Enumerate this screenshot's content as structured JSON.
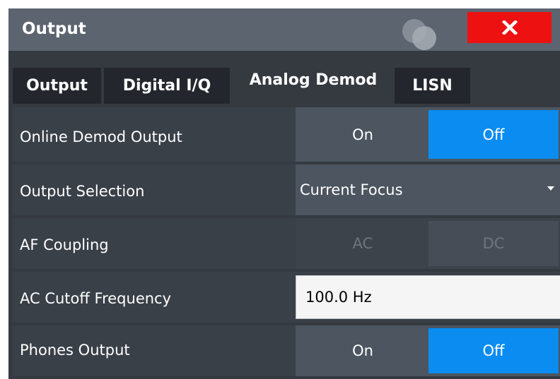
{
  "dialog": {
    "title": "Output",
    "close_label": "X"
  },
  "tabs": [
    {
      "label": "Output",
      "active": false
    },
    {
      "label": "Digital I/Q",
      "active": false
    },
    {
      "label": "Analog Demod",
      "active": true
    },
    {
      "label": "LISN",
      "active": false
    }
  ],
  "settings": {
    "online_demod": {
      "label": "Online Demod Output",
      "on": "On",
      "off": "Off",
      "selected": "Off"
    },
    "output_selection": {
      "label": "Output Selection",
      "value": "Current Focus"
    },
    "af_coupling": {
      "label": "AF Coupling",
      "ac": "AC",
      "dc": "DC",
      "selected": "DC",
      "enabled": false
    },
    "ac_cutoff": {
      "label": "AC Cutoff Frequency",
      "value": "100.0 Hz"
    },
    "phones_output": {
      "label": "Phones Output",
      "on": "On",
      "off": "Off",
      "selected": "Off"
    }
  },
  "colors": {
    "selected": "#0a8cf0",
    "close": "#ee1111",
    "panel": "#353a41",
    "titlebar": "#5c6470"
  },
  "icons": [
    "close-icon",
    "app-logo-icon",
    "chevron-down-icon"
  ]
}
